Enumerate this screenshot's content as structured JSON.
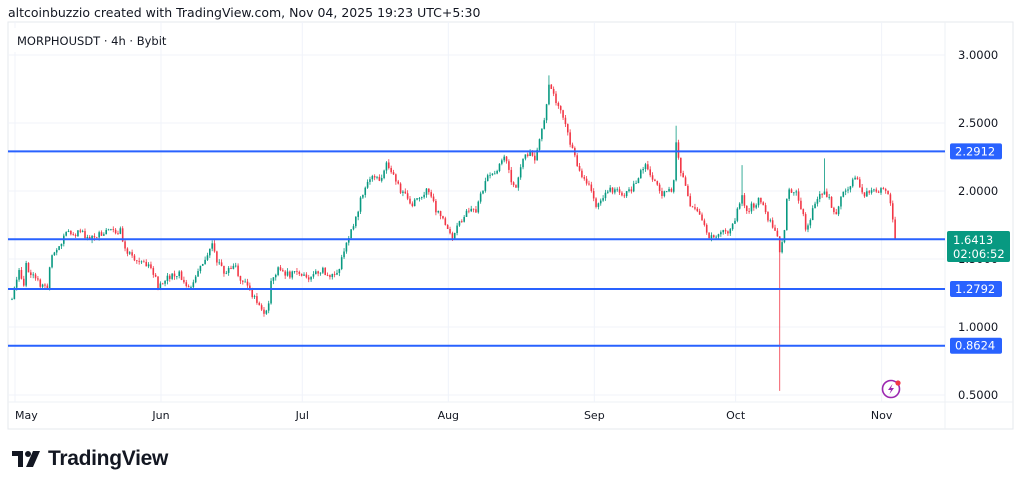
{
  "attribution": "altcoinbuzzio created with TradingView.com, Nov 04, 2025 19:23 UTC+5:30",
  "brand": "TradingView",
  "colors": {
    "up": "#089981",
    "down": "#f23645",
    "level": "#2962ff",
    "grid": "#f0f3fa",
    "alert": "#9c27b0"
  },
  "chart_data": {
    "type": "candlestick",
    "title": "MORPHOUSDT · 4h · Bybit",
    "symbol": "MORPHOUSDT",
    "interval": "4h",
    "exchange": "Bybit",
    "ylim": [
      0.45,
      3.05
    ],
    "grid": true,
    "y_ticks": [
      {
        "value": 3.0,
        "label": "3.0000"
      },
      {
        "value": 2.5,
        "label": "2.5000"
      },
      {
        "value": 2.0,
        "label": "2.0000"
      },
      {
        "value": 1.5,
        "label": "1.5000"
      },
      {
        "value": 1.0,
        "label": "1.0000"
      },
      {
        "value": 0.5,
        "label": "0.5000"
      }
    ],
    "x_ticks": [
      {
        "day": 0,
        "label": "May"
      },
      {
        "day": 31,
        "label": "Jun"
      },
      {
        "day": 61,
        "label": "Jul"
      },
      {
        "day": 92,
        "label": "Aug"
      },
      {
        "day": 123,
        "label": "Sep"
      },
      {
        "day": 153,
        "label": "Oct"
      },
      {
        "day": 184,
        "label": "Nov"
      }
    ],
    "price_path": [
      [
        0,
        1.2
      ],
      [
        1.7,
        1.42
      ],
      [
        2.3,
        1.24
      ],
      [
        2.8,
        1.46
      ],
      [
        4.9,
        1.35
      ],
      [
        7.7,
        1.27
      ],
      [
        8.1,
        1.49
      ],
      [
        10.2,
        1.6
      ],
      [
        11.3,
        1.68
      ],
      [
        14.5,
        1.7
      ],
      [
        16.6,
        1.65
      ],
      [
        18.7,
        1.68
      ],
      [
        20.9,
        1.7
      ],
      [
        23,
        1.71
      ],
      [
        24,
        1.57
      ],
      [
        26.2,
        1.49
      ],
      [
        29.4,
        1.46
      ],
      [
        31,
        1.31
      ],
      [
        32.6,
        1.35
      ],
      [
        34.7,
        1.4
      ],
      [
        35.7,
        1.38
      ],
      [
        37.4,
        1.27
      ],
      [
        38.9,
        1.38
      ],
      [
        41,
        1.48
      ],
      [
        42.6,
        1.6
      ],
      [
        43.8,
        1.46
      ],
      [
        45.3,
        1.4
      ],
      [
        47.4,
        1.46
      ],
      [
        48.5,
        1.35
      ],
      [
        50.6,
        1.27
      ],
      [
        51.7,
        1.2
      ],
      [
        53.2,
        1.11
      ],
      [
        54.5,
        1.16
      ],
      [
        54.9,
        1.35
      ],
      [
        56.6,
        1.42
      ],
      [
        59.1,
        1.38
      ],
      [
        61.3,
        1.4
      ],
      [
        63.4,
        1.35
      ],
      [
        65.5,
        1.42
      ],
      [
        68.1,
        1.38
      ],
      [
        69.8,
        1.46
      ],
      [
        70.9,
        1.64
      ],
      [
        72.3,
        1.71
      ],
      [
        74,
        1.93
      ],
      [
        75.1,
        2.04
      ],
      [
        76.6,
        2.12
      ],
      [
        78.3,
        2.08
      ],
      [
        79.4,
        2.19
      ],
      [
        80.9,
        2.15
      ],
      [
        82.6,
        1.97
      ],
      [
        83.6,
        2.01
      ],
      [
        84.7,
        1.86
      ],
      [
        85.7,
        1.93
      ],
      [
        87.9,
        2.01
      ],
      [
        88.9,
        1.97
      ],
      [
        90,
        1.86
      ],
      [
        91.1,
        1.82
      ],
      [
        92.1,
        1.77
      ],
      [
        93.6,
        1.65
      ],
      [
        95.3,
        1.79
      ],
      [
        97,
        1.86
      ],
      [
        98.5,
        1.86
      ],
      [
        99.6,
        1.97
      ],
      [
        101,
        2.12
      ],
      [
        102.8,
        2.15
      ],
      [
        103.8,
        2.23
      ],
      [
        104.9,
        2.23
      ],
      [
        106,
        2.08
      ],
      [
        107,
        2.01
      ],
      [
        108,
        2.19
      ],
      [
        109,
        2.26
      ],
      [
        110,
        2.3
      ],
      [
        111,
        2.23
      ],
      [
        112,
        2.38
      ],
      [
        113,
        2.52
      ],
      [
        114,
        2.78
      ],
      [
        115,
        2.71
      ],
      [
        116,
        2.63
      ],
      [
        117,
        2.56
      ],
      [
        118,
        2.41
      ],
      [
        119,
        2.3
      ],
      [
        120,
        2.19
      ],
      [
        121,
        2.12
      ],
      [
        123,
        2.01
      ],
      [
        124,
        1.9
      ],
      [
        125,
        1.93
      ],
      [
        126,
        2.01
      ],
      [
        128,
        2.01
      ],
      [
        129,
        1.97
      ],
      [
        131.5,
        2.01
      ],
      [
        133.6,
        2.15
      ],
      [
        134.7,
        2.19
      ],
      [
        136.8,
        2.04
      ],
      [
        138.3,
        1.97
      ],
      [
        140,
        2.01
      ],
      [
        140.6,
        2.08
      ],
      [
        141,
        2.38
      ],
      [
        142,
        2.12
      ],
      [
        143,
        2.04
      ],
      [
        144,
        1.9
      ],
      [
        146.4,
        1.8
      ],
      [
        147.4,
        1.68
      ],
      [
        148.5,
        1.65
      ],
      [
        150.6,
        1.7
      ],
      [
        152.3,
        1.71
      ],
      [
        153.8,
        1.82
      ],
      [
        154.9,
        1.97
      ],
      [
        156,
        1.86
      ],
      [
        157.4,
        1.9
      ],
      [
        158.7,
        1.93
      ],
      [
        160.2,
        1.82
      ],
      [
        161.3,
        1.75
      ],
      [
        162.3,
        1.68
      ],
      [
        163,
        1.57
      ],
      [
        163.8,
        1.64
      ],
      [
        164.7,
        2.01
      ],
      [
        166.6,
        1.97
      ],
      [
        167.7,
        1.86
      ],
      [
        168.7,
        1.68
      ],
      [
        169.8,
        1.86
      ],
      [
        171.5,
        1.97
      ],
      [
        172.3,
        2.01
      ],
      [
        174,
        1.9
      ],
      [
        175,
        1.82
      ],
      [
        176.2,
        1.97
      ],
      [
        177.9,
        2.04
      ],
      [
        179,
        2.12
      ],
      [
        180,
        2.04
      ],
      [
        181,
        1.97
      ],
      [
        182.6,
        2.01
      ],
      [
        184.7,
        2.01
      ],
      [
        185.7,
        2.01
      ],
      [
        186.4,
        1.93
      ],
      [
        186.8,
        1.86
      ],
      [
        187.2,
        1.75
      ],
      [
        187.5,
        1.6413
      ]
    ],
    "notable_wicks": [
      {
        "day": 114,
        "high": 2.85
      },
      {
        "day": 141,
        "high": 2.48
      },
      {
        "day": 155,
        "high": 2.19
      },
      {
        "day": 163,
        "low": 0.53
      },
      {
        "day": 172.3,
        "high": 2.24
      }
    ],
    "horizontal_levels": [
      {
        "value": 2.2912,
        "label": "2.2912"
      },
      {
        "value": 1.6448,
        "label": "1.6448"
      },
      {
        "value": 1.2792,
        "label": "1.2792"
      },
      {
        "value": 0.8624,
        "label": "0.8624"
      }
    ],
    "last_price": {
      "value": 1.6413,
      "label": "1.6413",
      "countdown": "02:06:52"
    }
  }
}
